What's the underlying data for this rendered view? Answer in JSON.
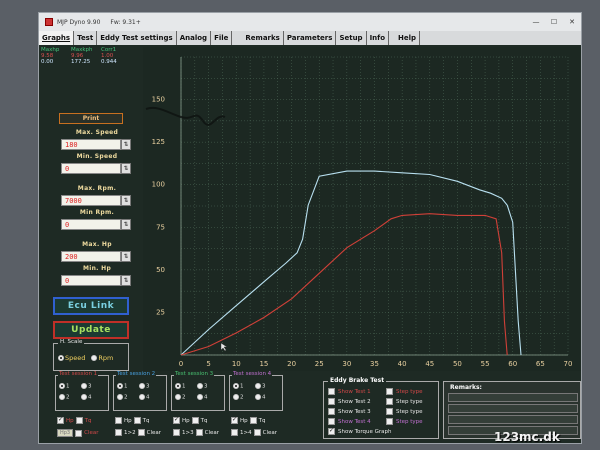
{
  "window": {
    "title": "MJP Dyno 9.90",
    "version": "Fw: 9.31+",
    "controls": [
      "—",
      "☐",
      "✕"
    ]
  },
  "menu": [
    "Graphs",
    "Test",
    "Eddy Test settings",
    "Analog",
    "File",
    "Remarks",
    "Parameters",
    "Setup",
    "Info",
    "Help"
  ],
  "stats": {
    "headers": [
      "Maxhp",
      "Maxkph",
      "Corr1"
    ],
    "row1": [
      "9.58",
      "9.96",
      "1.00"
    ],
    "row2": [
      "0.00",
      "177.25",
      "0.944"
    ]
  },
  "controls": {
    "print_label": "Print",
    "max_speed": {
      "label": "Max. Speed",
      "value": "180"
    },
    "min_speed": {
      "label": "Min. Speed",
      "value": "0"
    },
    "max_rpm": {
      "label": "Max. Rpm.",
      "value": "7000"
    },
    "min_rpm": {
      "label": "Min Rpm.",
      "value": "0"
    },
    "max_hp": {
      "label": "Max. Hp",
      "value": "200"
    },
    "min_hp": {
      "label": "Min. Hp",
      "value": "0"
    },
    "ecu_link": "Ecu Link",
    "update": "Update",
    "spin_glyph": "⇅"
  },
  "hscale": {
    "label": "H. Scale",
    "options": [
      "Speed",
      "Rpm"
    ],
    "selected": "Speed"
  },
  "sessions": [
    {
      "label": "Test session 1",
      "color": "#d04848",
      "radios": [
        "1",
        "2",
        "3",
        "4"
      ],
      "selected": "1"
    },
    {
      "label": "Test session 2",
      "color": "#48a0e0",
      "radios": [
        "1",
        "2",
        "3",
        "4"
      ],
      "selected": "1"
    },
    {
      "label": "Test session 3",
      "color": "#48c070",
      "radios": [
        "1",
        "2",
        "3",
        "4"
      ],
      "selected": "1"
    },
    {
      "label": "Test session 4",
      "color": "#c070d0",
      "radios": [
        "1",
        "2",
        "3",
        "4"
      ],
      "selected": "1"
    }
  ],
  "session_checks": {
    "hp": "Hp",
    "tq": "Tq",
    "btn_1": "Hp3",
    "clear_1": "Clear",
    "cmp_2": "1>2",
    "clear_2": "Clear",
    "cmp_3": "1>3",
    "clear_3": "Clear",
    "cmp_4": "1>4",
    "clear_4": "Clear"
  },
  "eddy": {
    "title": "Eddy Brake Test",
    "tests": [
      {
        "label": "Show Test 1",
        "color": "#d04848",
        "step": "Step type"
      },
      {
        "label": "Show Test 2",
        "color": "#e8e8e8",
        "step": "Step type"
      },
      {
        "label": "Show Test 3",
        "color": "#e8e8e8",
        "step": "Step type"
      },
      {
        "label": "Show Test 4",
        "color": "#c070d0",
        "step": "Step type"
      }
    ],
    "torque": "Show Torque Graph"
  },
  "remarks": {
    "title": "Remarks:"
  },
  "watermark": "123mc.dk",
  "colors": {
    "grid": "#4e6a58",
    "power_curve": "#b8e0f0",
    "speed_curve": "#d04038",
    "axis_text": "#e8d0a0"
  },
  "chart_data": {
    "type": "line",
    "x_ticks": [
      0,
      5,
      10,
      15,
      20,
      25,
      30,
      35,
      40,
      45,
      50,
      55,
      60,
      65,
      70
    ],
    "y_ticks": [
      25,
      50,
      75,
      100,
      125,
      150
    ],
    "xlim": [
      0,
      70
    ],
    "ylim": [
      0,
      175
    ],
    "grid": true,
    "series": [
      {
        "color": "#b8e0f0",
        "x": [
          0,
          5,
          10,
          15,
          19,
          21,
          22,
          23,
          25,
          30,
          35,
          40,
          45,
          50,
          54,
          56,
          58,
          59,
          60,
          61,
          61.5
        ],
        "y": [
          0,
          15,
          29,
          43,
          54,
          60,
          68,
          88,
          105,
          108,
          108,
          107,
          106,
          102,
          97,
          95,
          92,
          88,
          78,
          20,
          0
        ]
      },
      {
        "color": "#d04038",
        "x": [
          0,
          5,
          10,
          15,
          20,
          25,
          30,
          35,
          38,
          40,
          45,
          50,
          55,
          57,
          58,
          58.5,
          59
        ],
        "y": [
          0,
          5,
          13,
          22,
          33,
          48,
          63,
          73,
          80,
          82,
          83,
          82,
          82,
          80,
          60,
          20,
          0
        ]
      }
    ]
  }
}
